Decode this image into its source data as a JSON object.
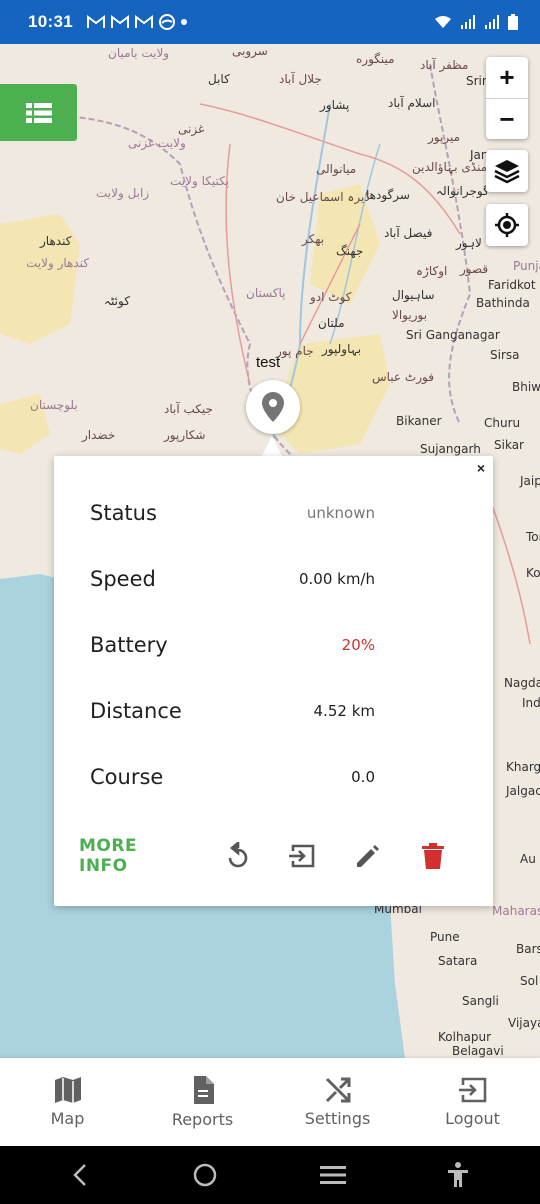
{
  "status_bar": {
    "time": "10:31",
    "notification_icons": [
      "gmail-icon",
      "gmail-icon",
      "gmail-icon",
      "browser-icon",
      "dot-icon"
    ],
    "system_icons": [
      "wifi-icon",
      "signal-icon",
      "signal-icon",
      "battery-icon"
    ]
  },
  "map": {
    "labels": [
      {
        "text": "ولایت بامیان",
        "cls": "prov"
      },
      {
        "text": "سروبی",
        "cls": ""
      },
      {
        "text": "کابل",
        "cls": "city"
      },
      {
        "text": "جلال آباد",
        "cls": ""
      },
      {
        "text": "مینگوره",
        "cls": ""
      },
      {
        "text": "مظفر آباد",
        "cls": ""
      },
      {
        "text": "Srin",
        "cls": "city"
      },
      {
        "text": "اسلام آباد",
        "cls": "city"
      },
      {
        "text": "پشاور",
        "cls": "city"
      },
      {
        "text": "ولایت غزنی",
        "cls": "prov"
      },
      {
        "text": "غزنی",
        "cls": ""
      },
      {
        "text": "میرپور",
        "cls": ""
      },
      {
        "text": "منڈی بہاؤالدین",
        "cls": ""
      },
      {
        "text": "میانوالی",
        "cls": ""
      },
      {
        "text": "پکتیکا ولایت",
        "cls": "prov"
      },
      {
        "text": "زابل ولایت",
        "cls": "prov"
      },
      {
        "text": "گوجرانوالہ",
        "cls": "city"
      },
      {
        "text": "سرگودھا",
        "cls": "city"
      },
      {
        "text": "ڈیرہ اسماعیل خان",
        "cls": ""
      },
      {
        "text": "کندهار",
        "cls": "city"
      },
      {
        "text": "کندهار ولایت",
        "cls": "prov"
      },
      {
        "text": "فیصل آباد",
        "cls": "city"
      },
      {
        "text": "جھنگ",
        "cls": "city"
      },
      {
        "text": "بھکر",
        "cls": ""
      },
      {
        "text": "لاہور",
        "cls": "city"
      },
      {
        "text": "Jan",
        "cls": "city"
      },
      {
        "text": "Punja",
        "cls": "prov"
      },
      {
        "text": "Faridkot",
        "cls": "city"
      },
      {
        "text": "Bathinda",
        "cls": "city"
      },
      {
        "text": "کوئٹہ",
        "cls": "city"
      },
      {
        "text": "پاکستان",
        "cls": "prov"
      },
      {
        "text": "ساہیوال",
        "cls": "city"
      },
      {
        "text": "اوکاڑہ",
        "cls": ""
      },
      {
        "text": "قصور",
        "cls": ""
      },
      {
        "text": "ملتان",
        "cls": "city"
      },
      {
        "text": "کوٹ ادو",
        "cls": ""
      },
      {
        "text": "بوریوالا",
        "cls": ""
      },
      {
        "text": "Sri Ganganagar",
        "cls": "city"
      },
      {
        "text": "Sirsa",
        "cls": "city"
      },
      {
        "text": "بہاولپور",
        "cls": "city"
      },
      {
        "text": "جام پور",
        "cls": ""
      },
      {
        "text": "فورٹ عباس",
        "cls": ""
      },
      {
        "text": "Bhiwa",
        "cls": "city"
      },
      {
        "text": "بلوچستان",
        "cls": "prov"
      },
      {
        "text": "جیکب آباد",
        "cls": ""
      },
      {
        "text": "شکارپور",
        "cls": ""
      },
      {
        "text": "خضدار",
        "cls": ""
      },
      {
        "text": "Bikaner",
        "cls": "city"
      },
      {
        "text": "Churu",
        "cls": "city"
      },
      {
        "text": "Sujangarh",
        "cls": "city"
      },
      {
        "text": "Sikar",
        "cls": "city"
      },
      {
        "text": "Jaip",
        "cls": "city"
      },
      {
        "text": "Tor",
        "cls": "city"
      },
      {
        "text": "Ko",
        "cls": "city"
      },
      {
        "text": "Nagda",
        "cls": "city"
      },
      {
        "text": "Ind",
        "cls": "city"
      },
      {
        "text": "Khargo",
        "cls": "city"
      },
      {
        "text": "Jalgac",
        "cls": "city"
      },
      {
        "text": "Au",
        "cls": "city"
      },
      {
        "text": "Mumbai",
        "cls": "city"
      },
      {
        "text": "Maharash",
        "cls": "prov"
      },
      {
        "text": "Pune",
        "cls": "city"
      },
      {
        "text": "Bars",
        "cls": "city"
      },
      {
        "text": "Satara",
        "cls": "city"
      },
      {
        "text": "Sol",
        "cls": "city"
      },
      {
        "text": "Sangli",
        "cls": "city"
      },
      {
        "text": "Vijaya",
        "cls": "city"
      },
      {
        "text": "Kolhapur",
        "cls": "city"
      },
      {
        "text": "Belagavi",
        "cls": "city"
      }
    ],
    "zoom_in_label": "+",
    "zoom_out_label": "−",
    "marker_label": "test"
  },
  "popup": {
    "close_label": "×",
    "rows": [
      {
        "key": "Status",
        "value": "unknown",
        "style": "muted"
      },
      {
        "key": "Speed",
        "value": "0.00 km/h",
        "style": ""
      },
      {
        "key": "Battery",
        "value": "20%",
        "style": "alert"
      },
      {
        "key": "Distance",
        "value": "4.52 km",
        "style": ""
      },
      {
        "key": "Course",
        "value": "0.0",
        "style": ""
      }
    ],
    "more_info_label": "MORE INFO",
    "action_icons": [
      "replay-icon",
      "command-icon",
      "edit-icon",
      "delete-icon"
    ],
    "colors": {
      "accent": "#4caf50",
      "alert": "#d32f2f"
    }
  },
  "bottom_nav": [
    {
      "label": "Map",
      "icon": "map-icon"
    },
    {
      "label": "Reports",
      "icon": "description-icon"
    },
    {
      "label": "Settings",
      "icon": "shuffle-icon"
    },
    {
      "label": "Logout",
      "icon": "logout-icon"
    }
  ],
  "system_nav": [
    "back-icon",
    "home-icon",
    "recents-icon",
    "accessibility-icon"
  ]
}
